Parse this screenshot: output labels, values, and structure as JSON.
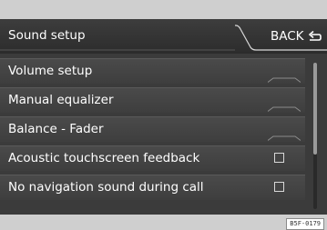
{
  "header": {
    "title": "Sound setup",
    "back_label": "BACK",
    "back_icon": "return-arrow-icon"
  },
  "menu": {
    "items": [
      {
        "label": "Volume setup",
        "control": "submenu"
      },
      {
        "label": "Manual equalizer",
        "control": "submenu"
      },
      {
        "label": "Balance - Fader",
        "control": "submenu"
      },
      {
        "label": "Acoustic touchscreen feedback",
        "control": "checkbox",
        "checked": false
      },
      {
        "label": "No navigation sound during call",
        "control": "checkbox",
        "checked": false
      }
    ]
  },
  "figure_code": "B5F-0179",
  "colors": {
    "background": "#3b3b3b",
    "text": "#ffffff",
    "frame": "#cfcfcf"
  }
}
